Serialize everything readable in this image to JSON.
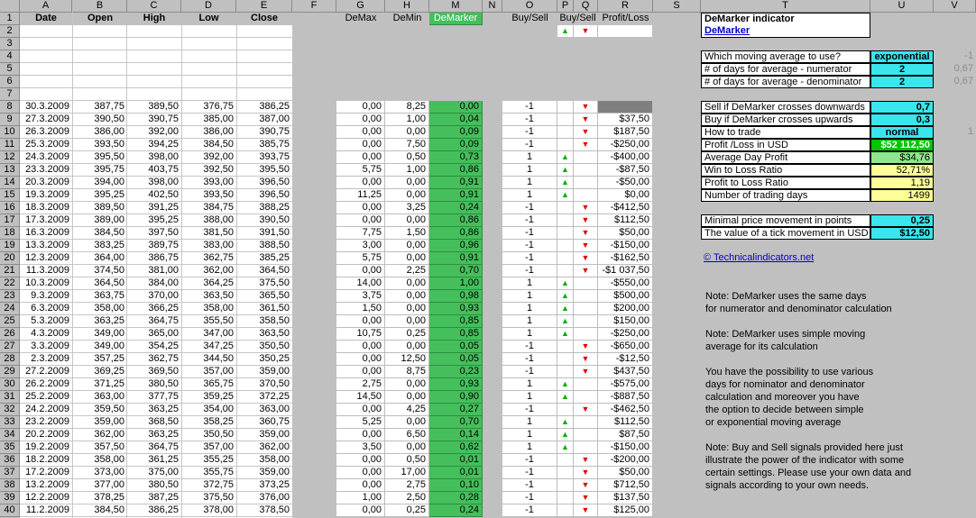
{
  "columns": [
    "A",
    "B",
    "C",
    "D",
    "E",
    "F",
    "G",
    "H",
    "M",
    "N",
    "O",
    "P",
    "Q",
    "R",
    "S",
    "T",
    "U",
    "V"
  ],
  "headers": {
    "date": "Date",
    "open": "Open",
    "high": "High",
    "low": "Low",
    "close": "Close",
    "demax": "DeMax",
    "demin": "DeMin",
    "demarker": "DeMarker",
    "buysell1": "Buy/Sell",
    "buysell2": "Buy/Sell",
    "profit": "Profit/Loss"
  },
  "row_numbers": [
    "1",
    "2",
    "3",
    "4",
    "5",
    "6",
    "7",
    "8",
    "9",
    "10",
    "11",
    "12",
    "13",
    "14",
    "15",
    "16",
    "17",
    "18",
    "19",
    "20",
    "21",
    "22",
    "23",
    "24",
    "25",
    "26",
    "27",
    "28",
    "29",
    "30",
    "31",
    "32",
    "33",
    "34",
    "35",
    "36",
    "37",
    "38",
    "39",
    "40"
  ],
  "q2": {
    "up": "▲",
    "down": "▼"
  },
  "rows": [
    [
      "30.3.2009",
      "387,75",
      "389,50",
      "376,75",
      "386,25",
      "0,00",
      "8,25",
      "0,00",
      "-1",
      "down",
      ""
    ],
    [
      "27.3.2009",
      "390,50",
      "390,75",
      "385,00",
      "387,00",
      "0,00",
      "1,00",
      "0,04",
      "-1",
      "down",
      "$37,50"
    ],
    [
      "26.3.2009",
      "386,00",
      "392,00",
      "386,00",
      "390,75",
      "0,00",
      "0,00",
      "0,09",
      "-1",
      "down",
      "$187,50"
    ],
    [
      "25.3.2009",
      "393,50",
      "394,25",
      "384,50",
      "385,75",
      "0,00",
      "7,50",
      "0,09",
      "-1",
      "down",
      "-$250,00"
    ],
    [
      "24.3.2009",
      "395,50",
      "398,00",
      "392,00",
      "393,75",
      "0,00",
      "0,50",
      "0,73",
      "1",
      "up",
      "-$400,00"
    ],
    [
      "23.3.2009",
      "395,75",
      "403,75",
      "392,50",
      "395,50",
      "5,75",
      "1,00",
      "0,86",
      "1",
      "up",
      "-$87,50"
    ],
    [
      "20.3.2009",
      "394,00",
      "398,00",
      "393,00",
      "396,50",
      "0,00",
      "0,00",
      "0,91",
      "1",
      "up",
      "-$50,00"
    ],
    [
      "19.3.2009",
      "395,25",
      "402,50",
      "393,50",
      "396,50",
      "11,25",
      "0,00",
      "0,91",
      "1",
      "up",
      "$0,00"
    ],
    [
      "18.3.2009",
      "389,50",
      "391,25",
      "384,75",
      "388,25",
      "0,00",
      "3,25",
      "0,24",
      "-1",
      "down",
      "-$412,50"
    ],
    [
      "17.3.2009",
      "389,00",
      "395,25",
      "388,00",
      "390,50",
      "0,00",
      "0,00",
      "0,86",
      "-1",
      "down",
      "$112,50"
    ],
    [
      "16.3.2009",
      "384,50",
      "397,50",
      "381,50",
      "391,50",
      "7,75",
      "1,50",
      "0,86",
      "-1",
      "down",
      "$50,00"
    ],
    [
      "13.3.2009",
      "383,25",
      "389,75",
      "383,00",
      "388,50",
      "3,00",
      "0,00",
      "0,96",
      "-1",
      "down",
      "-$150,00"
    ],
    [
      "12.3.2009",
      "364,00",
      "386,75",
      "362,75",
      "385,25",
      "5,75",
      "0,00",
      "0,91",
      "-1",
      "down",
      "-$162,50"
    ],
    [
      "11.3.2009",
      "374,50",
      "381,00",
      "362,00",
      "364,50",
      "0,00",
      "2,25",
      "0,70",
      "-1",
      "down",
      "-$1 037,50"
    ],
    [
      "10.3.2009",
      "364,50",
      "384,00",
      "364,25",
      "375,50",
      "14,00",
      "0,00",
      "1,00",
      "1",
      "up",
      "-$550,00"
    ],
    [
      "9.3.2009",
      "363,75",
      "370,00",
      "363,50",
      "365,50",
      "3,75",
      "0,00",
      "0,98",
      "1",
      "up",
      "$500,00"
    ],
    [
      "6.3.2009",
      "358,00",
      "366,25",
      "358,00",
      "361,50",
      "1,50",
      "0,00",
      "0,93",
      "1",
      "up",
      "$200,00"
    ],
    [
      "5.3.2009",
      "363,25",
      "364,75",
      "355,50",
      "358,50",
      "0,00",
      "0,00",
      "0,85",
      "1",
      "up",
      "$150,00"
    ],
    [
      "4.3.2009",
      "349,00",
      "365,00",
      "347,00",
      "363,50",
      "10,75",
      "0,25",
      "0,85",
      "1",
      "up",
      "-$250,00"
    ],
    [
      "3.3.2009",
      "349,00",
      "354,25",
      "347,25",
      "350,50",
      "0,00",
      "0,00",
      "0,05",
      "-1",
      "down",
      "-$650,00"
    ],
    [
      "2.3.2009",
      "357,25",
      "362,75",
      "344,50",
      "350,25",
      "0,00",
      "12,50",
      "0,05",
      "-1",
      "down",
      "-$12,50"
    ],
    [
      "27.2.2009",
      "369,25",
      "369,50",
      "357,00",
      "359,00",
      "0,00",
      "8,75",
      "0,23",
      "-1",
      "down",
      "$437,50"
    ],
    [
      "26.2.2009",
      "371,25",
      "380,50",
      "365,75",
      "370,50",
      "2,75",
      "0,00",
      "0,93",
      "1",
      "up",
      "-$575,00"
    ],
    [
      "25.2.2009",
      "363,00",
      "377,75",
      "359,25",
      "372,25",
      "14,50",
      "0,00",
      "0,90",
      "1",
      "up",
      "-$887,50"
    ],
    [
      "24.2.2009",
      "359,50",
      "363,25",
      "354,00",
      "363,00",
      "0,00",
      "4,25",
      "0,27",
      "-1",
      "down",
      "-$462,50"
    ],
    [
      "23.2.2009",
      "359,00",
      "368,50",
      "358,25",
      "360,75",
      "5,25",
      "0,00",
      "0,70",
      "1",
      "up",
      "$112,50"
    ],
    [
      "20.2.2009",
      "362,00",
      "363,25",
      "350,50",
      "359,00",
      "0,00",
      "6,50",
      "0,14",
      "1",
      "up",
      "$87,50"
    ],
    [
      "19.2.2009",
      "357,50",
      "364,75",
      "357,00",
      "362,00",
      "3,50",
      "0,00",
      "0,62",
      "1",
      "up",
      "-$150,00"
    ],
    [
      "18.2.2009",
      "358,00",
      "361,25",
      "355,25",
      "358,00",
      "0,00",
      "0,50",
      "0,01",
      "-1",
      "down",
      "-$200,00"
    ],
    [
      "17.2.2009",
      "373,00",
      "375,00",
      "355,75",
      "359,00",
      "0,00",
      "17,00",
      "0,01",
      "-1",
      "down",
      "$50,00"
    ],
    [
      "13.2.2009",
      "377,00",
      "380,50",
      "372,75",
      "373,25",
      "0,00",
      "2,75",
      "0,10",
      "-1",
      "down",
      "$712,50"
    ],
    [
      "12.2.2009",
      "378,25",
      "387,25",
      "375,50",
      "376,00",
      "1,00",
      "2,50",
      "0,28",
      "-1",
      "down",
      "$137,50"
    ],
    [
      "11.2.2009",
      "384,50",
      "386,25",
      "378,00",
      "378,50",
      "0,00",
      "0,25",
      "0,24",
      "-1",
      "down",
      "$125,00"
    ]
  ],
  "panel": {
    "title": "DeMarker indicator",
    "link": "DeMarker",
    "settings": [
      {
        "label": "Which moving average to use?",
        "value": "exponential",
        "side": "-1"
      },
      {
        "label": "# of days for average - numerator",
        "value": "2",
        "side": "0,67"
      },
      {
        "label": "# of days for average - denominator",
        "value": "2",
        "side": "0,67"
      }
    ],
    "results": [
      {
        "label": "Sell if DeMarker crosses downwards",
        "value": "0,7"
      },
      {
        "label": "Buy if DeMarker crosses upwards",
        "value": "0,3"
      },
      {
        "label": "How to trade",
        "value": "normal",
        "side": "1"
      },
      {
        "label": "Profit /Loss in USD",
        "value": "$52 112,50"
      },
      {
        "label": "Average Day Profit",
        "value": "$34,76"
      },
      {
        "label": "Win to Loss Ratio",
        "value": "52,71%"
      },
      {
        "label": "Profit to Loss Ratio",
        "value": "1,19"
      },
      {
        "label": "Number of trading days",
        "value": "1499"
      }
    ],
    "tick": [
      {
        "label": "Minimal price movement in points",
        "value": "0,25"
      },
      {
        "label": "The value of a tick movement in USD",
        "value": "$12,50"
      }
    ],
    "copyright": "© Technicalindicators.net",
    "notes": [
      "Note: DeMarker uses the same days",
      "for numerator and denominator calculation",
      "",
      "Note: DeMarker uses simple moving",
      "average for its calculation",
      "",
      "You have the possibility to use various",
      "days for nominator and denominator",
      "calculation and moreover you have",
      "the option to decide between simple",
      "or exponential moving average",
      "",
      "Note: Buy and Sell signals provided here just",
      "illustrate the power of the indicator with some",
      "certain settings. Please use your own data and",
      "signals according to your own needs."
    ]
  },
  "colors": {
    "green_header": "#44bf5c",
    "cyan": "#39e6ee",
    "yellow": "#ffff99",
    "profit_green": "#00c400",
    "avg_green": "#8ee68e",
    "up_arrow": "#00b000",
    "down_arrow": "#e00000"
  }
}
